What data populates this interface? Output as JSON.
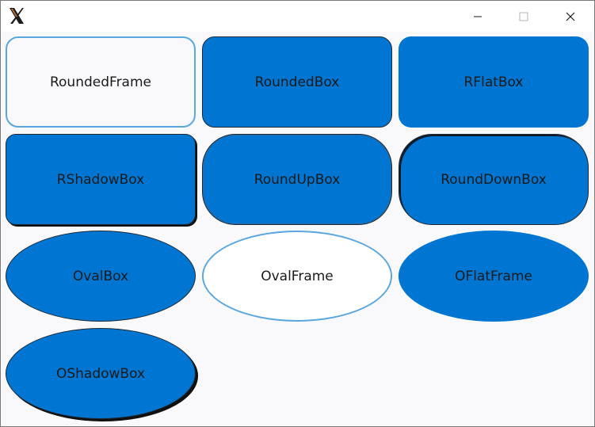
{
  "window": {
    "controls": {
      "minimize": "minimize",
      "maximize": "maximize",
      "close": "close"
    }
  },
  "icons": {
    "app": "x-logo-icon",
    "minimize": "minimize-icon",
    "maximize": "maximize-icon",
    "close": "close-icon"
  },
  "colors": {
    "fill": "#0075d2",
    "frame": "#5aa7e0",
    "outline": "#1f2933",
    "background": "#f9f9fb"
  },
  "boxes": {
    "rounded_frame": "RoundedFrame",
    "rounded_box": "RoundedBox",
    "rflat_box": "RFlatBox",
    "rshadow_box": "RShadowBox",
    "roundup_box": "RoundUpBox",
    "rounddown_box": "RoundDownBox",
    "oval_box": "OvalBox",
    "oval_frame": "OvalFrame",
    "oflat_frame": "OFlatFrame",
    "oshadow_box": "OShadowBox"
  }
}
